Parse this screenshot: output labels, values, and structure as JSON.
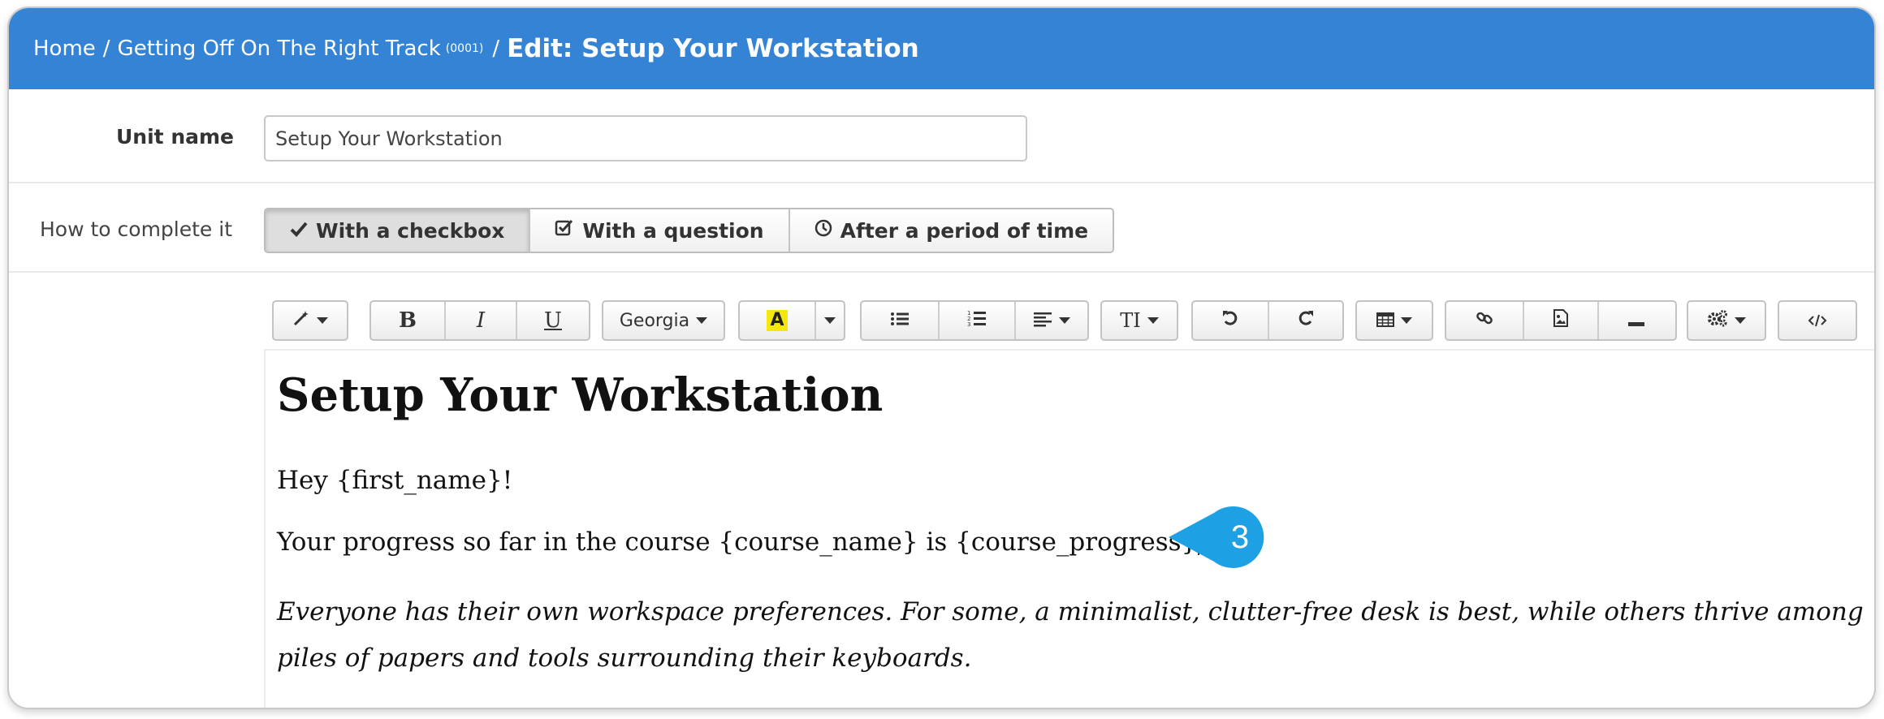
{
  "breadcrumb": {
    "home": "Home",
    "separator": "/",
    "course": "Getting Off On The Right Track",
    "course_code": "(0001)",
    "current": "Edit: Setup Your Workstation"
  },
  "unit_name": {
    "label": "Unit name",
    "value": "Setup Your Workstation"
  },
  "completion": {
    "label": "How to complete it",
    "options": [
      {
        "label": "With a checkbox",
        "icon": "check-icon",
        "active": true
      },
      {
        "label": "With a question",
        "icon": "checkbox-icon",
        "active": false
      },
      {
        "label": "After a period of time",
        "icon": "clock-icon",
        "active": false
      }
    ]
  },
  "toolbar": {
    "style_icon": "magic-wand-icon",
    "bold": "B",
    "italic": "I",
    "underline": "U",
    "font": "Georgia",
    "highlight": "A",
    "highlight_color": "#f5e60c",
    "font_size_icon": "TI"
  },
  "editor": {
    "title": "Setup Your Workstation",
    "greeting": "Hey {first_name}!",
    "progress": "Your progress so far in the course {course_name} is {course_progress}",
    "paragraph": "Everyone has their own workspace preferences. For some, a minimalist, clutter-free desk is best, while others thrive among piles of papers and tools surrounding their keyboards."
  },
  "callout": {
    "number": "3",
    "color": "#1ea1e4"
  },
  "colors": {
    "header": "#3483d4"
  }
}
